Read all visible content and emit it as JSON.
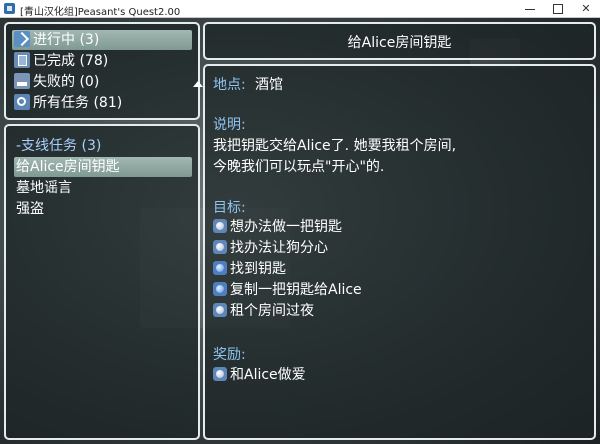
{
  "window": {
    "title": "[青山汉化组]Peasant's Quest2.00"
  },
  "status_list": [
    {
      "label": "进行中 (3)",
      "icon": "progress-icon",
      "selected": true
    },
    {
      "label": "已完成 (78)",
      "icon": "completed-icon",
      "selected": false
    },
    {
      "label": "失败的 (0)",
      "icon": "failed-icon",
      "selected": false
    },
    {
      "label": "所有任务 (81)",
      "icon": "all-quests-icon",
      "selected": false
    }
  ],
  "quest_list": {
    "category": "-支线任务 (3)",
    "items": [
      "给Alice房间钥匙",
      "墓地谣言",
      "强盗"
    ],
    "selected_index": 0
  },
  "detail": {
    "title": "给Alice房间钥匙",
    "location_label": "地点:",
    "location_value": "酒馆",
    "description_label": "说明:",
    "description_line1": "我把钥匙交给Alice了. 她要我租个房间,",
    "description_line2": "今晚我们可以玩点\"开心\"的.",
    "objectives_label": "目标:",
    "objectives": [
      {
        "text": "想办法做一把钥匙",
        "state": "pending"
      },
      {
        "text": "找办法让狗分心",
        "state": "pending"
      },
      {
        "text": "找到钥匙",
        "state": "active"
      },
      {
        "text": "复制一把钥匙给Alice",
        "state": "active"
      },
      {
        "text": "租个房间过夜",
        "state": "pending"
      }
    ],
    "reward_label": "奖励:",
    "reward": "和Alice做爱"
  },
  "colors": {
    "label_blue": "#8fc4f0",
    "selection": "#8fa9a2",
    "window_border": "#e6ecec"
  }
}
